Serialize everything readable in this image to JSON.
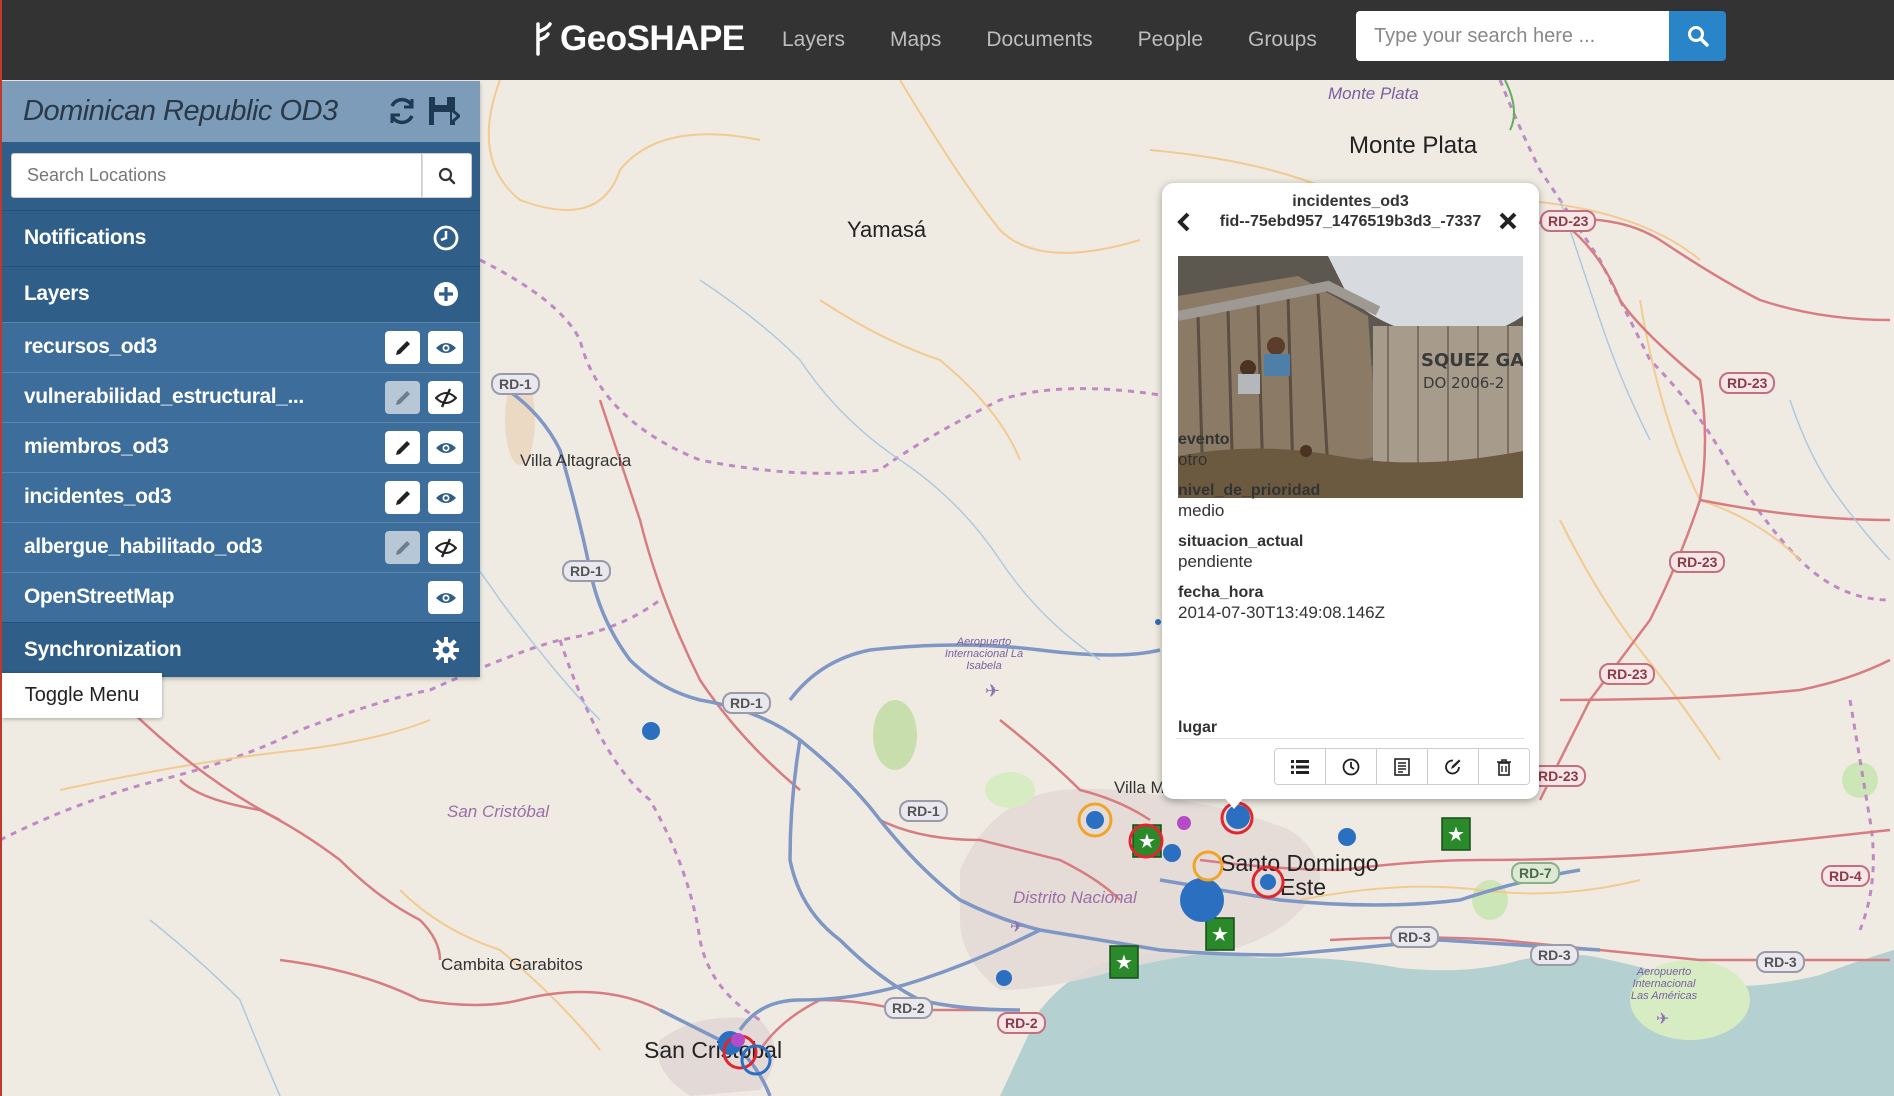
{
  "navbar": {
    "brand": "GeoSHAPE",
    "links": [
      "Layers",
      "Maps",
      "Documents",
      "People",
      "Groups"
    ],
    "search_placeholder": "Type your search here ..."
  },
  "panel": {
    "title": "Dominican Republic OD3",
    "location_placeholder": "Search Locations",
    "notifications_label": "Notifications",
    "layers_label": "Layers",
    "layers": [
      {
        "name": "recursos_od3",
        "editable": true,
        "visible": true
      },
      {
        "name": "vulnerabilidad_estructural_...",
        "editable": false,
        "visible": false
      },
      {
        "name": "miembros_od3",
        "editable": true,
        "visible": true
      },
      {
        "name": "incidentes_od3",
        "editable": true,
        "visible": true
      },
      {
        "name": "albergue_habilitado_od3",
        "editable": false,
        "visible": false
      }
    ],
    "basemap_label": "OpenStreetMap",
    "sync_label": "Synchronization",
    "toggle_menu": "Toggle Menu"
  },
  "popup": {
    "layer": "incidentes_od3",
    "feature_id": "fid--75ebd957_1476519b3d3_-7337",
    "fields": [
      {
        "key": "evento",
        "value": "otro"
      },
      {
        "key": "nivel_de_prioridad",
        "value": "medio"
      },
      {
        "key": "situacion_actual",
        "value": "pendiente"
      },
      {
        "key": "fecha_hora",
        "value": "2014-07-30T13:49:08.146Z"
      },
      {
        "key": "lugar",
        "value": ""
      }
    ],
    "toolbar_icons": [
      "list-icon",
      "history-icon",
      "document-icon",
      "edit-icon",
      "trash-icon"
    ]
  },
  "map": {
    "places": {
      "monte_plata_region": "Monte Plata",
      "monte_plata": "Monte Plata",
      "yamasa": "Yamasá",
      "villa_altagracia": "Villa Altagracia",
      "san_cristobal_province": "San Cristóbal",
      "cambita": "Cambita Garabitos",
      "distrito_nacional": "Distrito Nacional",
      "santo_domingo_1": "Santo Domingo",
      "santo_domingo_2": "Este",
      "villa_m": "Villa M",
      "san_cristobal_city": "San Cristobal",
      "airport_isabela": "Aeropuerto Internacional La Isabela",
      "airport_americas": "Aeropuerto Internacional Las Américas"
    },
    "road_shields": {
      "rd1_a": "RD-1",
      "rd1_b": "RD-1",
      "rd1_c": "RD-1",
      "rd1_d": "RD-1",
      "rd2_a": "RD-2",
      "rd2_b": "RD-2",
      "rd3_a": "RD-3",
      "rd3_b": "RD-3",
      "rd3_c": "RD-3",
      "rd23_a": "RD-23",
      "rd23_b": "RD-23",
      "rd23_c": "RD-23",
      "rd23_d": "RD-23",
      "rd23_e": "RD-23",
      "rd4": "RD-4",
      "rd7": "RD-7"
    }
  },
  "colors": {
    "navbar": "#333333",
    "accent": "#2a85c8",
    "panel_dark": "#2f5e88",
    "panel_row": "#3d6d9a",
    "panel_head": "#7c9cba",
    "sea": "#b5d0d0",
    "land": "#efebe2",
    "boundary": "#b678c0"
  }
}
